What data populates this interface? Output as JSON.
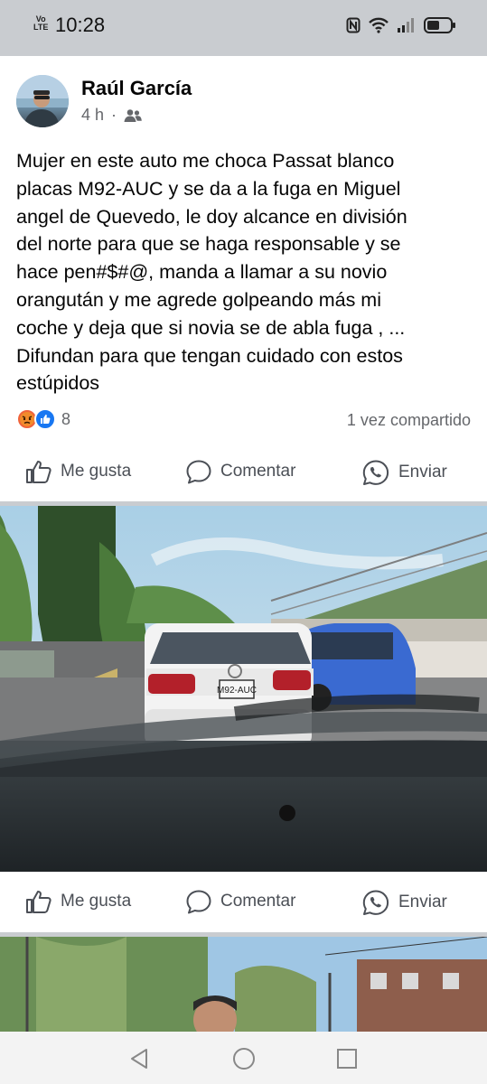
{
  "status_bar": {
    "network_top": "Vo",
    "network_bottom": "LTE",
    "time": "10:28"
  },
  "post": {
    "author": "Raúl García",
    "time": "4 h",
    "audience_icon": "friends-icon",
    "text": "Mujer en este auto me choca Passat  blanco\nplacas M92-AUC  y se da a la fuga en Miguel\nangel de Quevedo, le doy alcance en división\ndel norte para que se haga responsable y se\nhace pen#$#@, manda a llamar a su novio\norangután y me agrede golpeando más mi\ncoche y deja que si novia se de abla fuga , ...\nDifundan para que tengan cuidado con estos\nestúpidos",
    "reaction_count": "8",
    "shares": "1 vez compartido",
    "actions": {
      "like": "Me gusta",
      "comment": "Comentar",
      "send": "Enviar"
    }
  },
  "photo_card": {
    "plate": "M92-AUC",
    "actions": {
      "like": "Me gusta",
      "comment": "Comentar",
      "send": "Enviar"
    }
  },
  "colors": {
    "status_bg": "#c9ccd0",
    "text": "#050505",
    "secondary": "#65676b",
    "like_blue": "#1877f2",
    "angry": "#f0633b"
  }
}
